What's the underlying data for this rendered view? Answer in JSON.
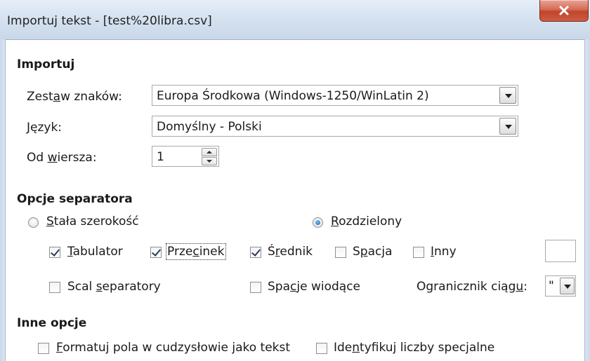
{
  "window": {
    "title": "Importuj tekst - [test%20libra.csv]",
    "close_icon": "close-x-icon"
  },
  "import": {
    "heading": "Importuj",
    "charset": {
      "label_pre": "Zest",
      "label_acc": "a",
      "label_post": "w znaków:",
      "value": "Europa Środkowa (Windows-1250/WinLatin 2)"
    },
    "language": {
      "label_acc": "J",
      "label_post": "ęzyk:",
      "value": "Domyślny - Polski"
    },
    "from_row": {
      "label_pre": "Od ",
      "label_acc": "w",
      "label_post": "iersza:",
      "value": "1"
    }
  },
  "separator": {
    "heading": "Opcje separatora",
    "fixed_width": {
      "label_acc": "S",
      "label_post": "tała szerokość",
      "selected": false
    },
    "separated": {
      "label_acc": "R",
      "label_post": "ozdzielony",
      "selected": true
    },
    "tab": {
      "label_acc": "T",
      "label_post": "abulator",
      "checked": true
    },
    "comma": {
      "label_pre": "Prze",
      "label_acc": "c",
      "label_post": "inek",
      "checked": true
    },
    "semicolon": {
      "label_pre": "Ś",
      "label_acc": "r",
      "label_post": "ednik",
      "checked": true
    },
    "space": {
      "label_pre": "S",
      "label_acc": "p",
      "label_post": "acja",
      "checked": false
    },
    "other": {
      "label_acc": "I",
      "label_post": "nny",
      "checked": false,
      "value": ""
    },
    "merge": {
      "label_pre": "Scal ",
      "label_acc": "s",
      "label_post": "eparatory",
      "checked": false
    },
    "trim": {
      "label_pre": "Spa",
      "label_acc": "c",
      "label_post": "je wiodące",
      "checked": false
    },
    "quote": {
      "label_pre": "Ogranicznik ciąg",
      "label_acc": "u",
      "label_post": ":",
      "value": "\""
    }
  },
  "other_options": {
    "heading": "Inne opcje",
    "quoted_as_text": {
      "label_acc": "F",
      "label_post": "ormatuj pola w cudzysłowie jako tekst",
      "checked": false
    },
    "detect_special": {
      "label_pre": "Ide",
      "label_acc": "n",
      "label_post": "tyfikuj liczby specjalne",
      "checked": false
    }
  }
}
